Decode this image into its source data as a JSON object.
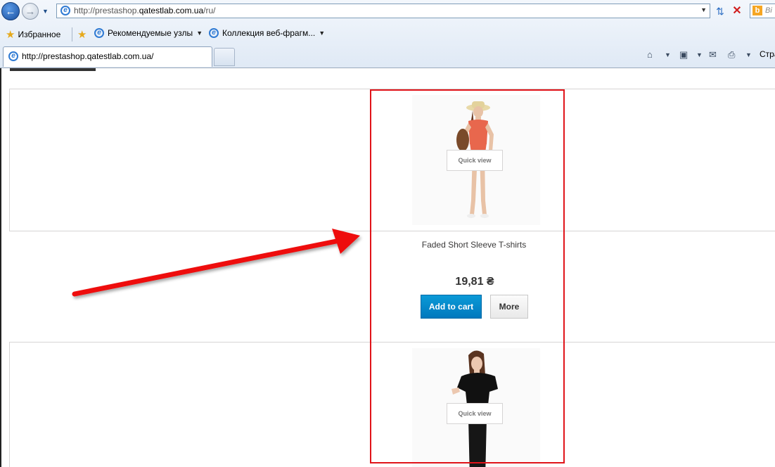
{
  "browser": {
    "address_bar": {
      "url_prefix": "http://prestashop.",
      "url_domain": "qatestlab.com.ua",
      "url_suffix": "/ru/"
    },
    "search_placeholder": "Bi",
    "favorites_bar": {
      "favorites_label": "Избранное",
      "recommended_sites": "Рекомендуемые узлы",
      "web_slice_gallery": "Коллекция веб-фрагм..."
    },
    "tab": {
      "title": "http://prestashop.qatestlab.com.ua/"
    },
    "command_bar": {
      "page_label": "Стра"
    }
  },
  "products": [
    {
      "name": "Faded Short Sleeve T-shirts",
      "price": "19,81 ₴",
      "quick_view_label": "Quick view",
      "add_to_cart_label": "Add to cart",
      "more_label": "More"
    },
    {
      "quick_view_label": "Quick view"
    }
  ],
  "annotation": {
    "highlight_color": "#e0141a",
    "arrow_color": "#ee1111"
  },
  "colors": {
    "add_to_cart_bg": "#0088cc",
    "frame_border": "#d6d4d4"
  }
}
